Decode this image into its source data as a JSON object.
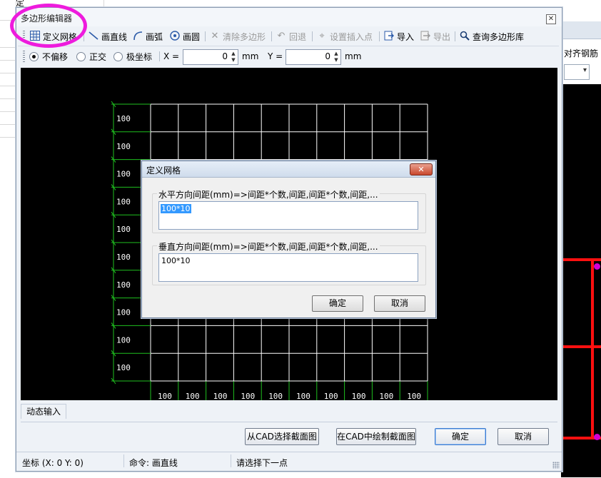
{
  "background": {
    "top_text": "定",
    "right_tab_label": "对齐钢筋"
  },
  "window": {
    "title": "多边形编辑器",
    "close_icon": "close-icon"
  },
  "toolbar": {
    "items": [
      {
        "label": "定义网格",
        "icon": "grid-icon",
        "enabled": true
      },
      {
        "label": "画直线",
        "icon": "line-icon",
        "enabled": true
      },
      {
        "label": "画弧",
        "icon": "arc-icon",
        "enabled": true
      },
      {
        "label": "画圆",
        "icon": "circle-icon",
        "enabled": true
      },
      {
        "label": "清除多边形",
        "icon": "clear-icon",
        "enabled": false
      },
      {
        "label": "回退",
        "icon": "undo-icon",
        "enabled": false
      },
      {
        "label": "设置插入点",
        "icon": "insert-point-icon",
        "enabled": false
      },
      {
        "label": "导入",
        "icon": "import-icon",
        "enabled": true
      },
      {
        "label": "导出",
        "icon": "export-icon",
        "enabled": false
      },
      {
        "label": "查询多边形库",
        "icon": "search-icon",
        "enabled": true
      }
    ]
  },
  "coord_bar": {
    "modes": [
      {
        "label": "不偏移",
        "selected": true
      },
      {
        "label": "正交",
        "selected": false
      },
      {
        "label": "极坐标",
        "selected": false
      }
    ],
    "x_label": "X =",
    "x_value": "0",
    "x_unit": "mm",
    "y_label": "Y =",
    "y_value": "0",
    "y_unit": "mm"
  },
  "canvas": {
    "row_labels": [
      "100",
      "100",
      "100",
      "100",
      "100",
      "100",
      "100",
      "100",
      "100",
      "100"
    ],
    "col_labels": [
      "100",
      "100",
      "100",
      "100",
      "100",
      "100",
      "100",
      "100",
      "100",
      "100"
    ],
    "grid_color": "#ffffff",
    "dim_color": "#1fbf1f"
  },
  "dialog": {
    "title": "定义网格",
    "horizontal_label": "水平方向间距(mm)=>间距*个数,间距,间距*个数,间距,...",
    "horizontal_value": "100*10",
    "vertical_label": "垂直方向间距(mm)=>间距*个数,间距,间距*个数,间距,...",
    "vertical_value": "100*10",
    "ok_label": "确定",
    "cancel_label": "取消"
  },
  "dynamic_input_tab": "动态输入",
  "buttons": {
    "select_from_cad": "从CAD选择截面图",
    "draw_in_cad": "在CAD中绘制截面图",
    "ok": "确定",
    "cancel": "取消"
  },
  "status": {
    "coord": "坐标 (X: 0 Y: 0)",
    "command": "命令: 画直线",
    "prompt": "请选择下一点"
  },
  "highlight_color": "#ee1bdd"
}
